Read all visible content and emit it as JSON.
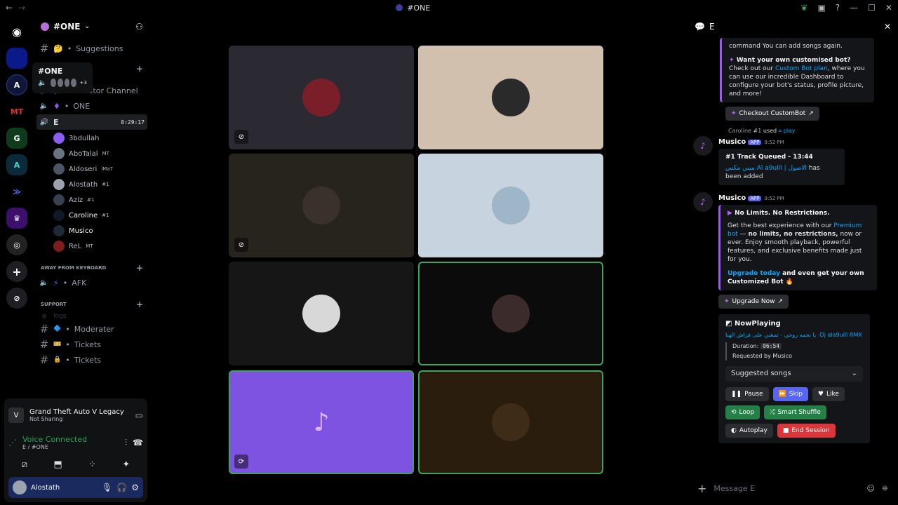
{
  "window": {
    "title": "#ONE"
  },
  "server": {
    "name": "#ONE"
  },
  "tooltip": {
    "title": "#ONE",
    "extra": "+3"
  },
  "channels": [
    {
      "name": "Suggestions",
      "emoji": "🤔"
    },
    {
      "name": "Creator Channel"
    },
    {
      "name": "ONE"
    },
    {
      "name": "E",
      "timer": "8:29:17"
    }
  ],
  "members": [
    {
      "name": "3bdullah",
      "color": "#8b5cf6"
    },
    {
      "name": "AboTalal",
      "tag": "MT",
      "color": "#6b7280"
    },
    {
      "name": "Aldoseri",
      "tag": "iMa7",
      "color": "#4b5563"
    },
    {
      "name": "Alostath",
      "tag": "#1",
      "color": "#9ca3af"
    },
    {
      "name": "Aziz",
      "tag": "#1",
      "color": "#374151"
    },
    {
      "name": "Caroline",
      "tag": "#1",
      "color": "#111827"
    },
    {
      "name": "Musico",
      "color": "#1f2937"
    },
    {
      "name": "ReL",
      "tag": "MT",
      "color": "#7f1d1d"
    }
  ],
  "categories": {
    "afk": "AWAY FROM KEYBOARD",
    "support": "SUPPORT"
  },
  "afk_channel": "AFK",
  "support_channels": [
    {
      "name": "logs"
    },
    {
      "name": "Moderater",
      "emoji": "🔷"
    },
    {
      "name": "Tickets",
      "emoji": "🎫"
    },
    {
      "name": "Tickets",
      "emoji": "🔒"
    }
  ],
  "activity": {
    "game": "Grand Theft Auto V Legacy",
    "status": "Not Sharing"
  },
  "voice": {
    "status": "Voice Connected",
    "channel": "E / #ONE"
  },
  "me": {
    "name": "Alostath"
  },
  "panel": {
    "title": "E"
  },
  "messages": {
    "top_text": "command You can add songs again.",
    "custom_title": "Want your own customised bot?",
    "custom_line1": "Check out our",
    "custom_link": "Custom Bot plan",
    "custom_line2": ", where you can use our incredible Dashboard to configure your bot's status, profile picture, and more!",
    "custom_btn": "Checkout CustomBot",
    "reply_user": "Caroline",
    "reply_tag": "#1",
    "reply_used": "used",
    "reply_cmd": "play",
    "bot_name": "Musico",
    "app_label": "APP",
    "time1": "9:52 PM",
    "queued_title": "#1 Track Queued - 13:44",
    "queued_song": "ميني مكس Al a9ulll | الاصول",
    "queued_suffix": "has been added",
    "time2": "9:52 PM",
    "promo_title": "No Limits. No Restrictions.",
    "promo_a": "Get the best experience with our",
    "promo_link": "Premium bot",
    "promo_b": "— ",
    "promo_bold": "no limits, no restrictions,",
    "promo_c": " now or ever. Enjoy smooth playback, powerful features, and exclusive benefits made just for you.",
    "upgrade_link": "Upgrade today",
    "upgrade_rest": "and even get your own Customized Bot",
    "upgrade_btn": "Upgrade Now",
    "np_title": "NowPlaying",
    "np_song": "يا نجمه روحي - تمشي على فراش الهنا -Dj ala9ulll RMX",
    "np_duration_label": "Duration:",
    "np_duration": "06:54",
    "np_requested": "Requested by Musico",
    "select_label": "Suggested songs",
    "btn_pause": "Pause",
    "btn_skip": "Skip",
    "btn_like": "Like",
    "btn_loop": "Loop",
    "btn_shuffle": "Smart Shuffle",
    "btn_autoplay": "Autoplay",
    "btn_end": "End Session"
  },
  "composer": {
    "placeholder": "Message E"
  },
  "tiles": [
    {
      "bg": "#2b2a33",
      "avatar": "#7a1f2a",
      "badge": "camera-off-icon"
    },
    {
      "bg": "#d2c0ae",
      "avatar": "#2a2a2a"
    },
    {
      "bg": "#27241e",
      "avatar": "#3a322a",
      "badge": "camera-off-icon"
    },
    {
      "bg": "#c7d3df",
      "avatar": "#9fb6c8"
    },
    {
      "bg": "#161616",
      "avatar": "#d8d8d8"
    },
    {
      "bg": "#0b0b0b",
      "avatar": "#3b2b2b",
      "speaking": true
    },
    {
      "bg": "#7f53e1",
      "avatar": "#b266ff",
      "speaking": true,
      "badge": "activity-icon"
    },
    {
      "bg": "#2b1d0d",
      "avatar": "#3e2b18",
      "speaking": true
    }
  ]
}
